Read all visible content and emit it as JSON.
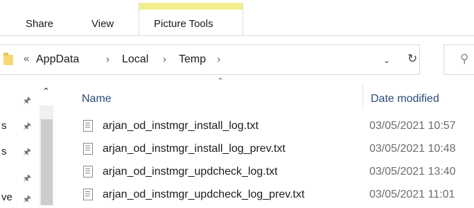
{
  "ribbon": {
    "tabs": [
      {
        "label": "Share"
      },
      {
        "label": "View"
      },
      {
        "label": "Picture Tools"
      }
    ]
  },
  "address": {
    "overflow": "«",
    "crumbs": [
      "AppData",
      "Local",
      "Temp"
    ],
    "separator": "›",
    "dropdown_icon": "chevron-down-icon",
    "refresh_icon": "refresh-icon",
    "search_icon": "search-icon"
  },
  "nav": {
    "items": [
      {
        "label": "s"
      },
      {
        "label": "s"
      },
      {
        "label": ""
      },
      {
        "label": "ve"
      }
    ]
  },
  "columns": {
    "name": "Name",
    "date": "Date modified"
  },
  "files": [
    {
      "name": "arjan_od_instmgr_install_log.txt",
      "date": "03/05/2021 10:57"
    },
    {
      "name": "arjan_od_instmgr_install_log_prev.txt",
      "date": "03/05/2021 10:48"
    },
    {
      "name": "arjan_od_instmgr_updcheck_log.txt",
      "date": "03/05/2021 13:40"
    },
    {
      "name": "arjan_od_instmgr_updcheck_log_prev.txt",
      "date": "03/05/2021 11:01"
    }
  ]
}
